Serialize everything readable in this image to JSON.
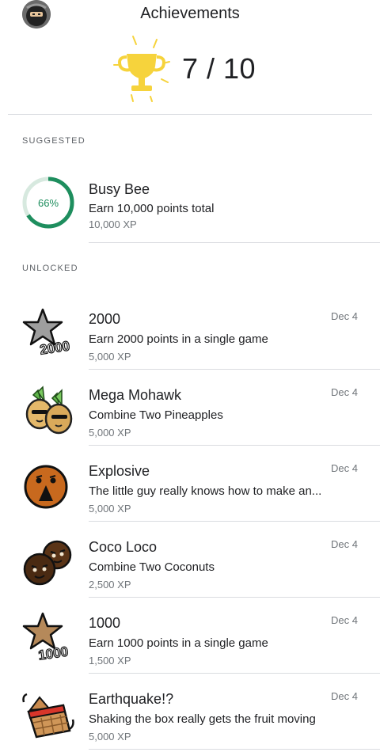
{
  "header": {
    "title": "Achievements",
    "score": "7 / 10",
    "avatar_icon": "ninja-avatar-icon",
    "trophy_icon": "trophy-icon"
  },
  "sections": {
    "suggested": "SUGGESTED",
    "unlocked": "UNLOCKED"
  },
  "suggested": [
    {
      "name": "Busy Bee",
      "description": "Earn 10,000 points total",
      "xp": "10,000 XP",
      "progress_label": "66%",
      "progress": 0.66,
      "icon": "progress-ring-icon"
    }
  ],
  "unlocked": [
    {
      "name": "2000",
      "description": "Earn 2000 points in a single game",
      "xp": "5,000 XP",
      "date": "Dec 4",
      "icon": "star-2000-icon",
      "icon_text": "2000"
    },
    {
      "name": "Mega Mohawk",
      "description": "Combine Two Pineapples",
      "xp": "5,000 XP",
      "date": "Dec 4",
      "icon": "pineapples-icon"
    },
    {
      "name": "Explosive",
      "description": "The little guy really knows how to make an...",
      "xp": "5,000 XP",
      "date": "Dec 4",
      "icon": "explosive-face-icon"
    },
    {
      "name": "Coco Loco",
      "description": "Combine Two Coconuts",
      "xp": "2,500 XP",
      "date": "Dec 4",
      "icon": "coconuts-icon"
    },
    {
      "name": "1000",
      "description": "Earn 1000 points in a single game",
      "xp": "1,500 XP",
      "date": "Dec 4",
      "icon": "star-1000-icon",
      "icon_text": "1000"
    },
    {
      "name": "Earthquake!?",
      "description": "Shaking the box really gets the fruit moving",
      "xp": "5,000 XP",
      "date": "Dec 4",
      "icon": "fruit-basket-icon"
    }
  ],
  "colors": {
    "progress": "#1e8e5e",
    "progress_track": "#d7e9df",
    "trophy": "#f6d33c"
  }
}
